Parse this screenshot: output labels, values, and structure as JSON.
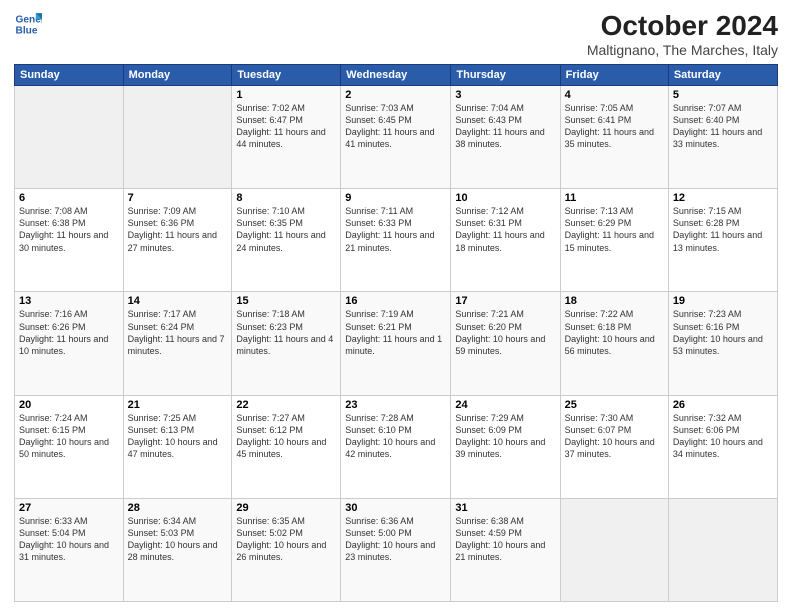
{
  "logo": {
    "line1": "General",
    "line2": "Blue"
  },
  "title": "October 2024",
  "subtitle": "Maltignano, The Marches, Italy",
  "days_of_week": [
    "Sunday",
    "Monday",
    "Tuesday",
    "Wednesday",
    "Thursday",
    "Friday",
    "Saturday"
  ],
  "weeks": [
    [
      {
        "day": "",
        "info": ""
      },
      {
        "day": "",
        "info": ""
      },
      {
        "day": "1",
        "info": "Sunrise: 7:02 AM\nSunset: 6:47 PM\nDaylight: 11 hours and 44 minutes."
      },
      {
        "day": "2",
        "info": "Sunrise: 7:03 AM\nSunset: 6:45 PM\nDaylight: 11 hours and 41 minutes."
      },
      {
        "day": "3",
        "info": "Sunrise: 7:04 AM\nSunset: 6:43 PM\nDaylight: 11 hours and 38 minutes."
      },
      {
        "day": "4",
        "info": "Sunrise: 7:05 AM\nSunset: 6:41 PM\nDaylight: 11 hours and 35 minutes."
      },
      {
        "day": "5",
        "info": "Sunrise: 7:07 AM\nSunset: 6:40 PM\nDaylight: 11 hours and 33 minutes."
      }
    ],
    [
      {
        "day": "6",
        "info": "Sunrise: 7:08 AM\nSunset: 6:38 PM\nDaylight: 11 hours and 30 minutes."
      },
      {
        "day": "7",
        "info": "Sunrise: 7:09 AM\nSunset: 6:36 PM\nDaylight: 11 hours and 27 minutes."
      },
      {
        "day": "8",
        "info": "Sunrise: 7:10 AM\nSunset: 6:35 PM\nDaylight: 11 hours and 24 minutes."
      },
      {
        "day": "9",
        "info": "Sunrise: 7:11 AM\nSunset: 6:33 PM\nDaylight: 11 hours and 21 minutes."
      },
      {
        "day": "10",
        "info": "Sunrise: 7:12 AM\nSunset: 6:31 PM\nDaylight: 11 hours and 18 minutes."
      },
      {
        "day": "11",
        "info": "Sunrise: 7:13 AM\nSunset: 6:29 PM\nDaylight: 11 hours and 15 minutes."
      },
      {
        "day": "12",
        "info": "Sunrise: 7:15 AM\nSunset: 6:28 PM\nDaylight: 11 hours and 13 minutes."
      }
    ],
    [
      {
        "day": "13",
        "info": "Sunrise: 7:16 AM\nSunset: 6:26 PM\nDaylight: 11 hours and 10 minutes."
      },
      {
        "day": "14",
        "info": "Sunrise: 7:17 AM\nSunset: 6:24 PM\nDaylight: 11 hours and 7 minutes."
      },
      {
        "day": "15",
        "info": "Sunrise: 7:18 AM\nSunset: 6:23 PM\nDaylight: 11 hours and 4 minutes."
      },
      {
        "day": "16",
        "info": "Sunrise: 7:19 AM\nSunset: 6:21 PM\nDaylight: 11 hours and 1 minute."
      },
      {
        "day": "17",
        "info": "Sunrise: 7:21 AM\nSunset: 6:20 PM\nDaylight: 10 hours and 59 minutes."
      },
      {
        "day": "18",
        "info": "Sunrise: 7:22 AM\nSunset: 6:18 PM\nDaylight: 10 hours and 56 minutes."
      },
      {
        "day": "19",
        "info": "Sunrise: 7:23 AM\nSunset: 6:16 PM\nDaylight: 10 hours and 53 minutes."
      }
    ],
    [
      {
        "day": "20",
        "info": "Sunrise: 7:24 AM\nSunset: 6:15 PM\nDaylight: 10 hours and 50 minutes."
      },
      {
        "day": "21",
        "info": "Sunrise: 7:25 AM\nSunset: 6:13 PM\nDaylight: 10 hours and 47 minutes."
      },
      {
        "day": "22",
        "info": "Sunrise: 7:27 AM\nSunset: 6:12 PM\nDaylight: 10 hours and 45 minutes."
      },
      {
        "day": "23",
        "info": "Sunrise: 7:28 AM\nSunset: 6:10 PM\nDaylight: 10 hours and 42 minutes."
      },
      {
        "day": "24",
        "info": "Sunrise: 7:29 AM\nSunset: 6:09 PM\nDaylight: 10 hours and 39 minutes."
      },
      {
        "day": "25",
        "info": "Sunrise: 7:30 AM\nSunset: 6:07 PM\nDaylight: 10 hours and 37 minutes."
      },
      {
        "day": "26",
        "info": "Sunrise: 7:32 AM\nSunset: 6:06 PM\nDaylight: 10 hours and 34 minutes."
      }
    ],
    [
      {
        "day": "27",
        "info": "Sunrise: 6:33 AM\nSunset: 5:04 PM\nDaylight: 10 hours and 31 minutes."
      },
      {
        "day": "28",
        "info": "Sunrise: 6:34 AM\nSunset: 5:03 PM\nDaylight: 10 hours and 28 minutes."
      },
      {
        "day": "29",
        "info": "Sunrise: 6:35 AM\nSunset: 5:02 PM\nDaylight: 10 hours and 26 minutes."
      },
      {
        "day": "30",
        "info": "Sunrise: 6:36 AM\nSunset: 5:00 PM\nDaylight: 10 hours and 23 minutes."
      },
      {
        "day": "31",
        "info": "Sunrise: 6:38 AM\nSunset: 4:59 PM\nDaylight: 10 hours and 21 minutes."
      },
      {
        "day": "",
        "info": ""
      },
      {
        "day": "",
        "info": ""
      }
    ]
  ]
}
